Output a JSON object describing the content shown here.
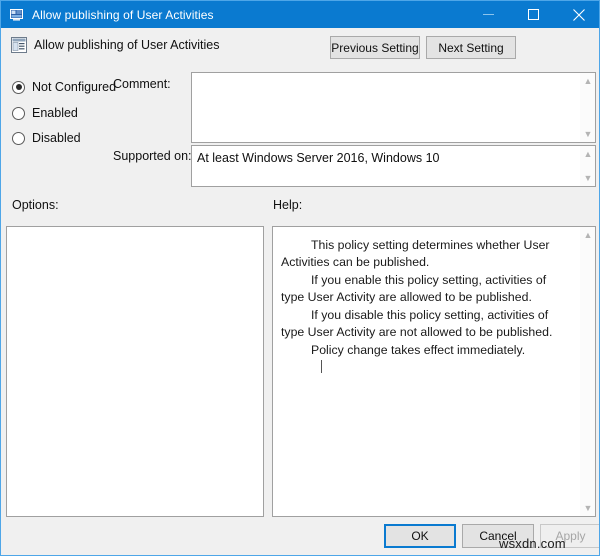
{
  "window": {
    "title": "Allow publishing of User Activities",
    "icon": "policy-editor-icon",
    "controls": {
      "minimize": "–",
      "maximize": "☐",
      "close": "✕"
    }
  },
  "header": {
    "icon": "policy-setting-icon",
    "title": "Allow publishing of User Activities",
    "previous_setting_label": "Previous Setting",
    "next_setting_label": "Next Setting"
  },
  "state": {
    "options": [
      {
        "label": "Not Configured",
        "selected": true
      },
      {
        "label": "Enabled",
        "selected": false
      },
      {
        "label": "Disabled",
        "selected": false
      }
    ]
  },
  "comment": {
    "label": "Comment:",
    "value": "",
    "placeholder": ""
  },
  "supported_on": {
    "label": "Supported on:",
    "value": "At least Windows Server 2016, Windows 10"
  },
  "options_pane": {
    "label": "Options:",
    "content": ""
  },
  "help_pane": {
    "label": "Help:",
    "paragraphs": [
      "This policy setting determines whether User Activities can be published.",
      "If you enable this policy setting, activities of type User Activity are allowed to be published.",
      "If you disable this policy setting, activities of type User Activity are not allowed to be published.",
      "Policy change takes effect immediately."
    ]
  },
  "footer": {
    "ok_label": "OK",
    "cancel_label": "Cancel",
    "apply_label": "Apply",
    "apply_disabled": true
  },
  "watermark": {
    "text": "wsxdn.com"
  },
  "colors": {
    "titlebar": "#0a7ad0",
    "dialog_background": "#f0f0f0",
    "border": "#4ea6e8",
    "focus": "#0a7ad0"
  }
}
